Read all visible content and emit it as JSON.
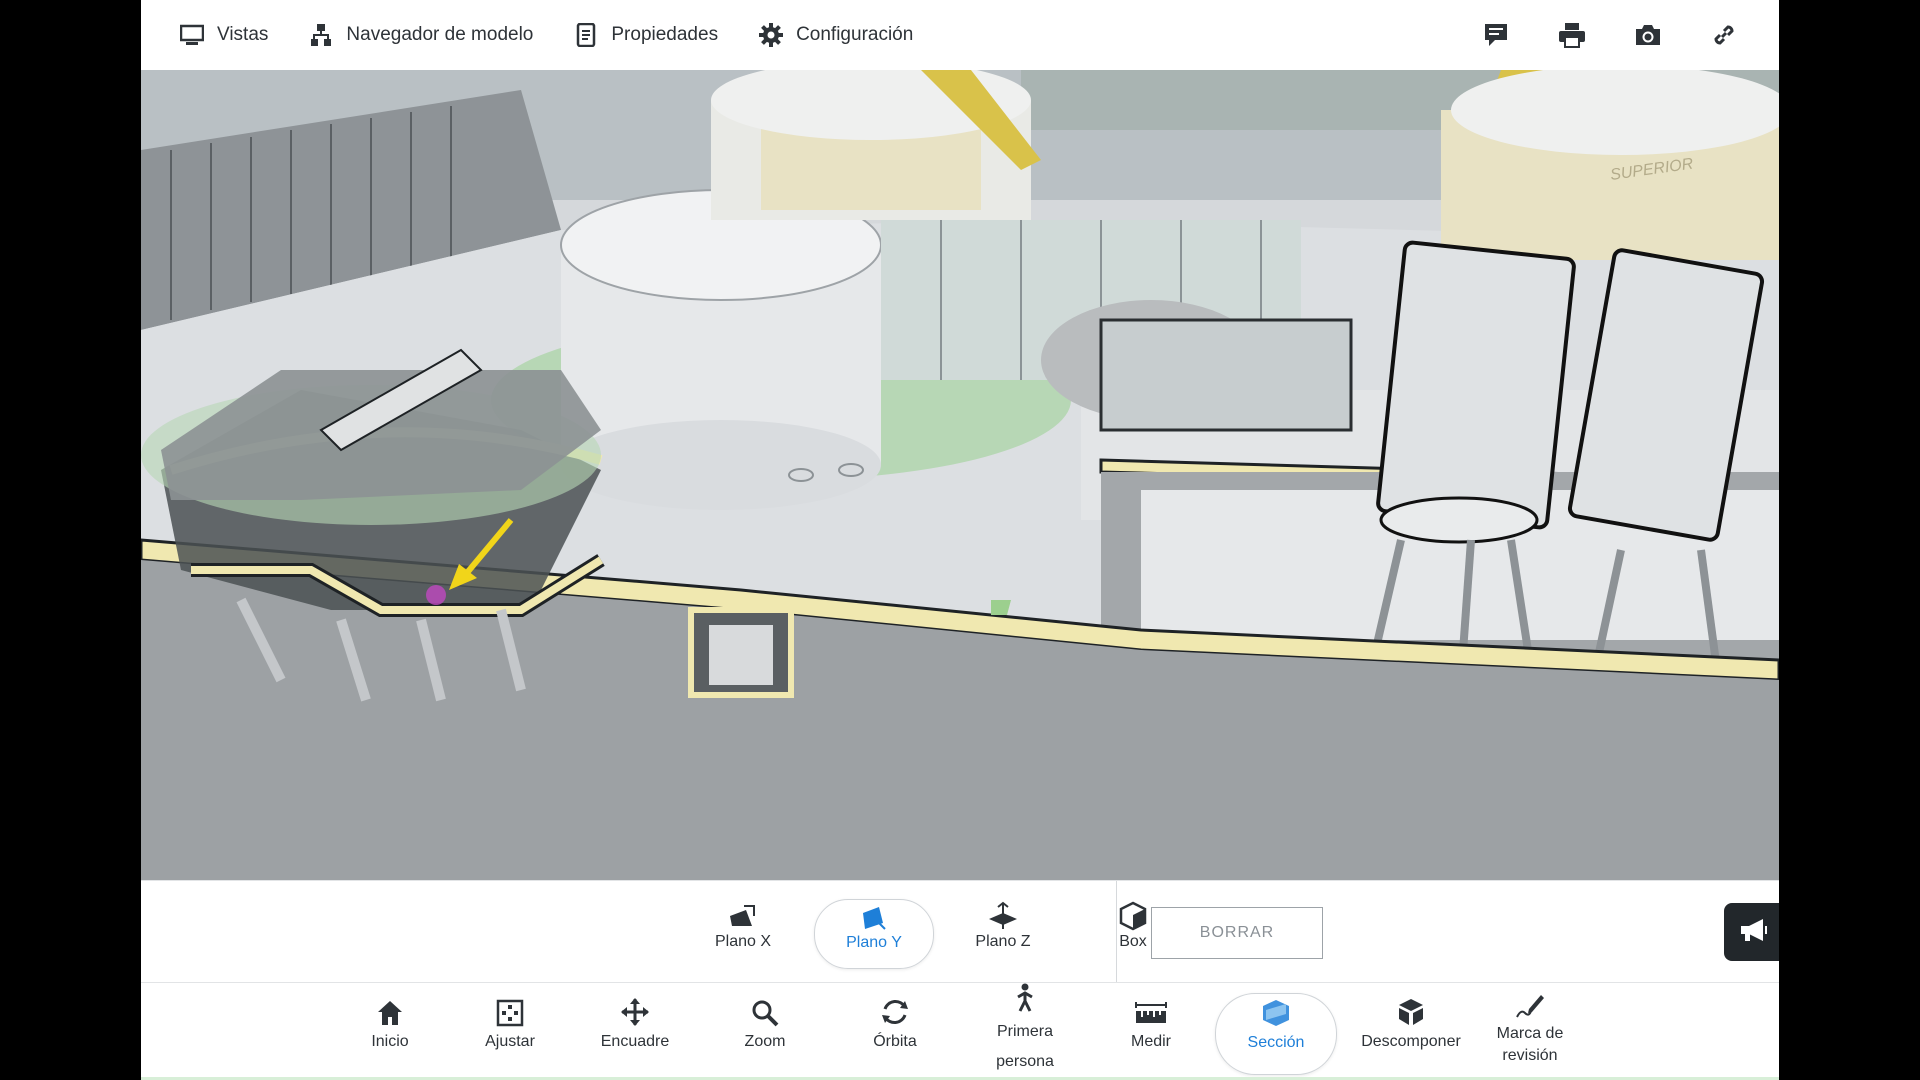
{
  "topbar": {
    "items": [
      {
        "label": "Vistas",
        "icon": "monitor-icon"
      },
      {
        "label": "Navegador de modelo",
        "icon": "model-tree-icon"
      },
      {
        "label": "Propiedades",
        "icon": "properties-icon"
      },
      {
        "label": "Configuración",
        "icon": "gear-icon"
      }
    ],
    "right_icons": [
      "comment-icon",
      "print-icon",
      "camera-icon",
      "link-icon"
    ]
  },
  "viewport": {
    "description_icon": "3d-model-viewport",
    "tank_label": "SUPERIOR"
  },
  "section_toolbar": {
    "buttons": [
      {
        "label": "Plano X",
        "icon": "plane-x-icon",
        "active": false
      },
      {
        "label": "Plano Y",
        "icon": "plane-y-icon",
        "active": true
      },
      {
        "label": "Plano Z",
        "icon": "plane-z-icon",
        "active": false
      },
      {
        "label": "Box",
        "icon": "box-icon",
        "active": false
      }
    ],
    "clear_label": "BORRAR",
    "announce_icon": "megaphone-icon"
  },
  "bottom_toolbar": {
    "buttons": [
      {
        "label": "Inicio",
        "icon": "home-icon",
        "active": false
      },
      {
        "label": "Ajustar",
        "icon": "fit-icon",
        "active": false
      },
      {
        "label": "Encuadre",
        "icon": "pan-icon",
        "active": false
      },
      {
        "label": "Zoom",
        "icon": "zoom-icon",
        "active": false
      },
      {
        "label": "Órbita",
        "icon": "orbit-icon",
        "active": false
      },
      {
        "label": "Primera\npersona",
        "icon": "first-person-icon",
        "active": false
      },
      {
        "label": "Medir",
        "icon": "measure-icon",
        "active": false
      },
      {
        "label": "Sección",
        "icon": "section-icon",
        "active": true
      },
      {
        "label": "Descomponer",
        "icon": "explode-icon",
        "active": false
      },
      {
        "label": "Marca de\nrevisión",
        "icon": "markup-icon",
        "active": false
      }
    ]
  },
  "colors": {
    "accent": "#1e7fd8",
    "section_cap": "#f0e8b0",
    "ground_green": "#b7d7b5"
  }
}
